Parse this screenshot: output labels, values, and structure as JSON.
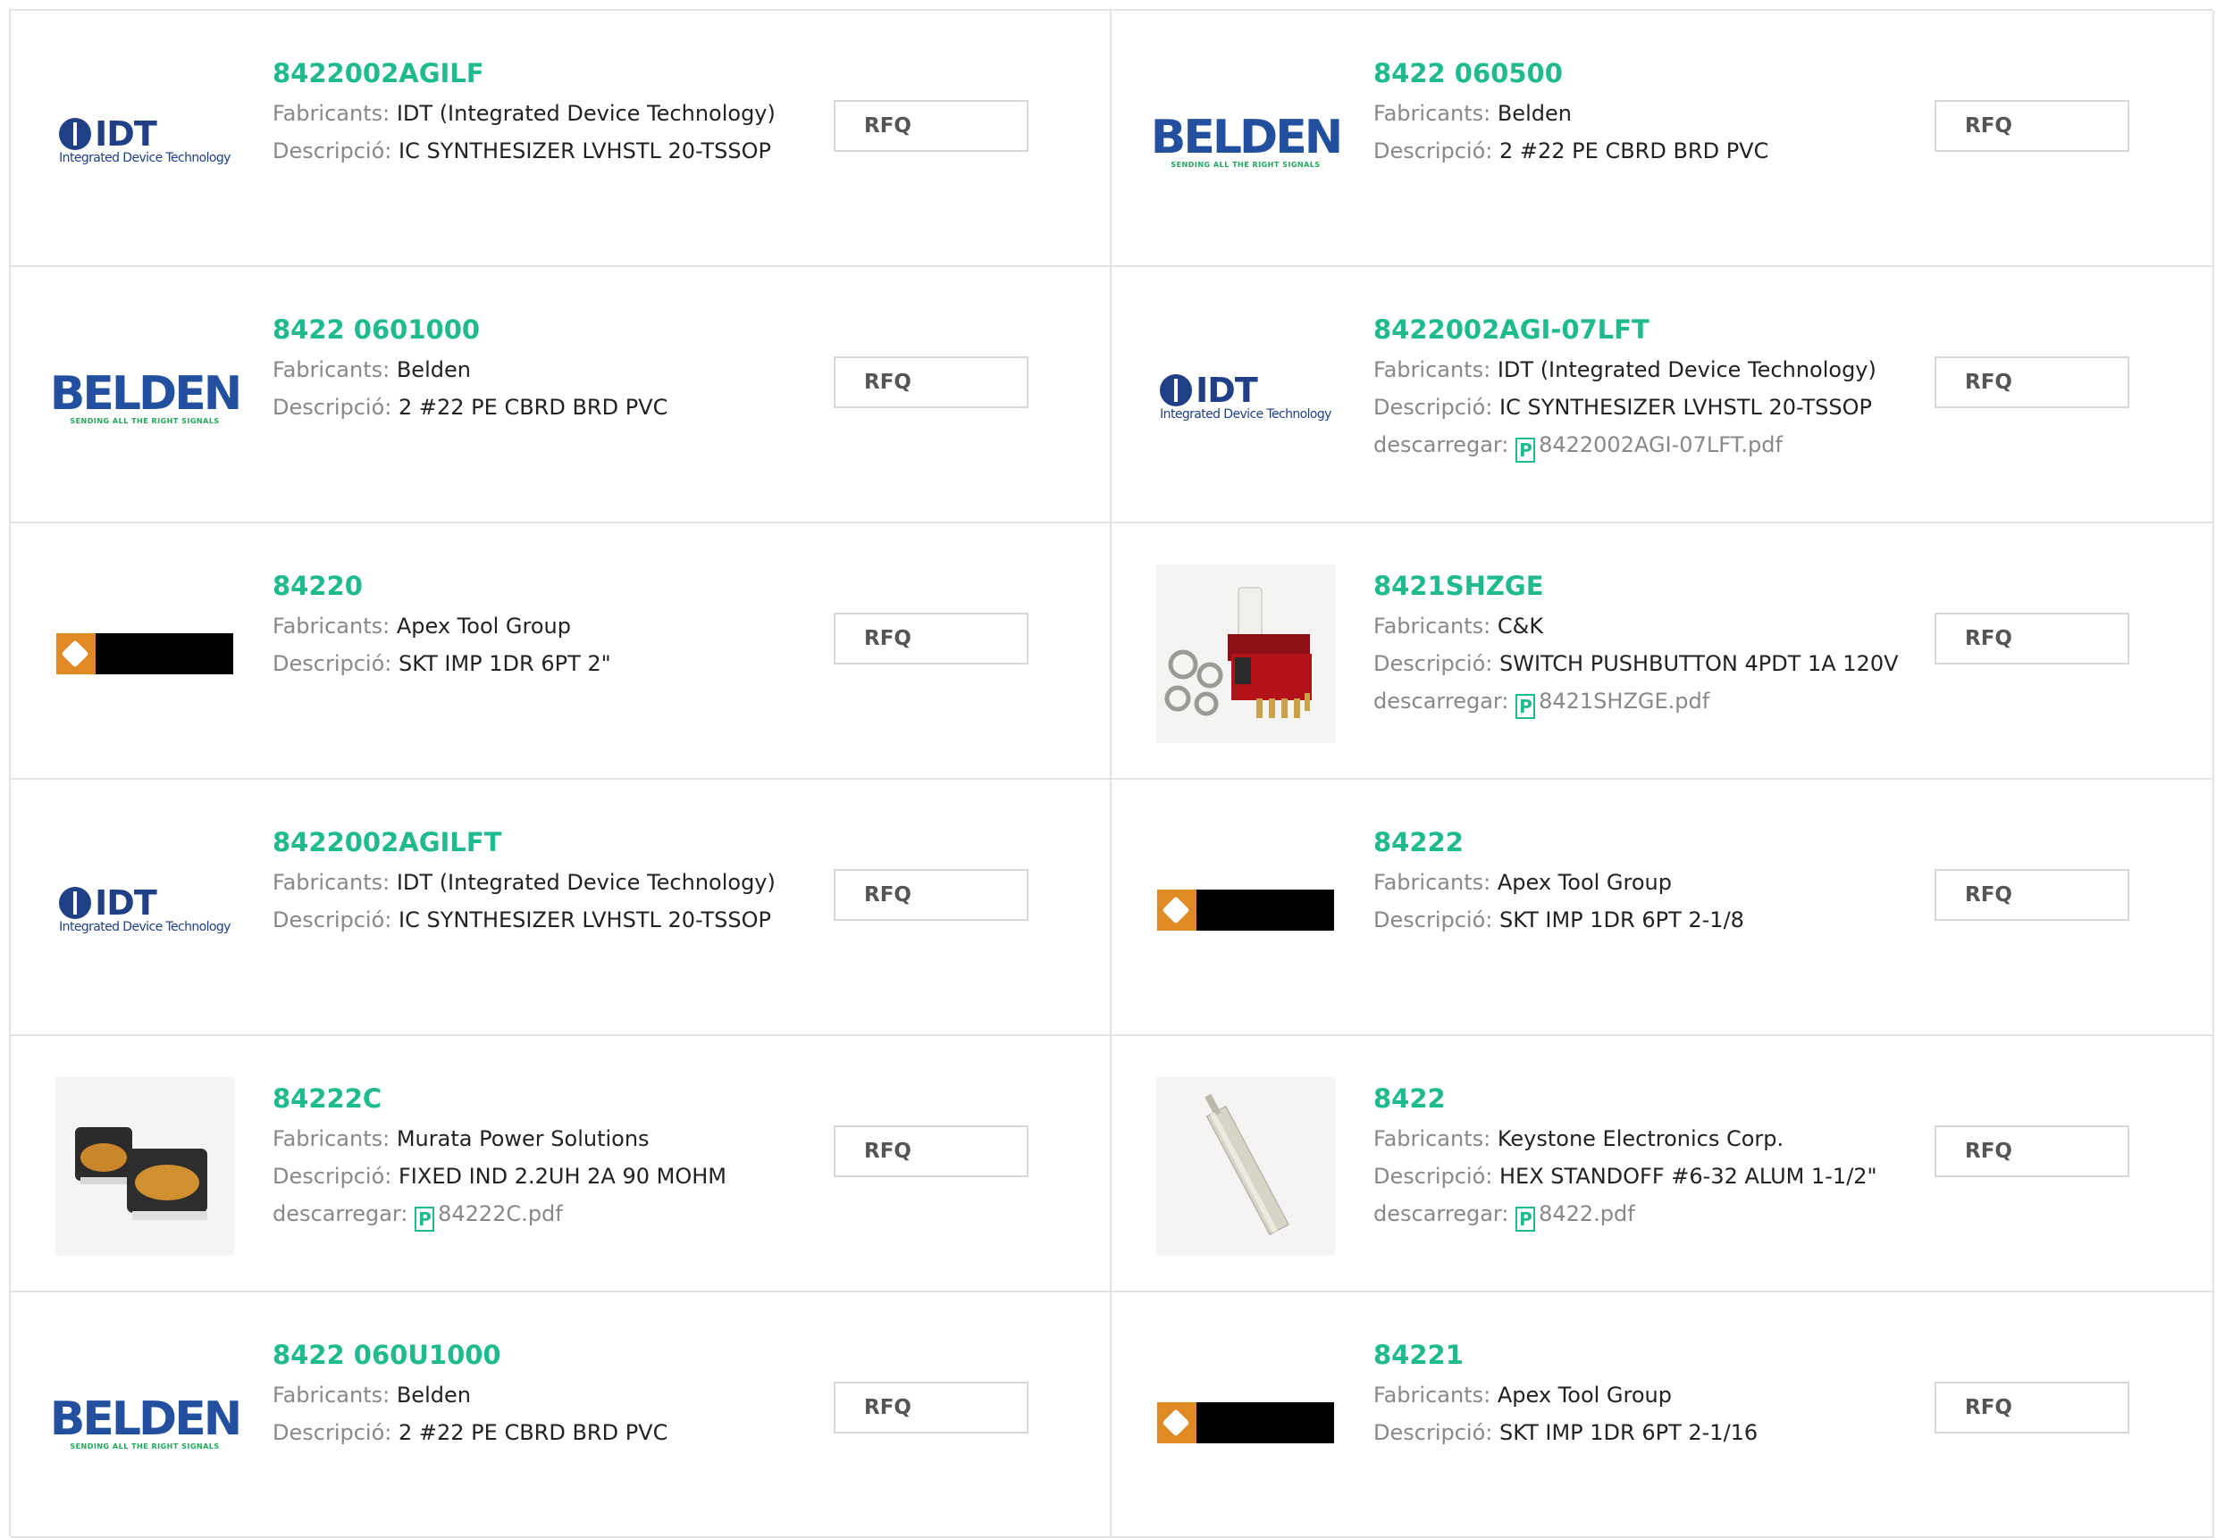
{
  "labels": {
    "manufacturer": "Fabricants:",
    "description": "Descripció:",
    "download": "descarregar:",
    "rfq": "RFQ",
    "pdf_glyph": "P"
  },
  "colors": {
    "accent": "#1fbb8f",
    "label": "#888888",
    "border": "#e3e3e3"
  },
  "products": [
    {
      "part": "8422002AGILF",
      "manufacturer": "IDT (Integrated Device Technology)",
      "description": "IC SYNTHESIZER LVHSTL 20-TSSOP",
      "logo": "idt-logo",
      "logo_text": "IDT",
      "logo_sub": "Integrated Device Technology"
    },
    {
      "part": "8422 060500",
      "manufacturer": "Belden",
      "description": "2 #22 PE CBRD BRD PVC",
      "logo": "belden-logo",
      "logo_text": "BELDEN",
      "logo_sub": "SENDING ALL THE RIGHT SIGNALS"
    },
    {
      "part": "8422 0601000",
      "manufacturer": "Belden",
      "description": "2 #22 PE CBRD BRD PVC",
      "logo": "belden-logo",
      "logo_text": "BELDEN",
      "logo_sub": "SENDING ALL THE RIGHT SIGNALS"
    },
    {
      "part": "8422002AGI-07LFT",
      "manufacturer": "IDT (Integrated Device Technology)",
      "description": "IC SYNTHESIZER LVHSTL 20-TSSOP",
      "download": "8422002AGI-07LFT.pdf",
      "logo": "idt-logo",
      "logo_text": "IDT",
      "logo_sub": "Integrated Device Technology"
    },
    {
      "part": "84220",
      "manufacturer": "Apex Tool Group",
      "description": "SKT IMP 1DR 6PT 2\"",
      "logo": "apex-logo"
    },
    {
      "part": "8421SHZGE",
      "manufacturer": "C&K",
      "description": "SWITCH PUSHBUTTON 4PDT 1A 120V",
      "download": "8421SHZGE.pdf",
      "logo": "switch-photo"
    },
    {
      "part": "8422002AGILFT",
      "manufacturer": "IDT (Integrated Device Technology)",
      "description": "IC SYNTHESIZER LVHSTL 20-TSSOP",
      "logo": "idt-logo",
      "logo_text": "IDT",
      "logo_sub": "Integrated Device Technology"
    },
    {
      "part": "84222",
      "manufacturer": "Apex Tool Group",
      "description": "SKT IMP 1DR 6PT 2-1/8",
      "logo": "apex-logo"
    },
    {
      "part": "84222C",
      "manufacturer": "Murata Power Solutions",
      "description": "FIXED IND 2.2UH 2A 90 MOHM",
      "download": "84222C.pdf",
      "logo": "inductor-photo"
    },
    {
      "part": "8422",
      "manufacturer": "Keystone Electronics Corp.",
      "description": "HEX STANDOFF #6-32 ALUM 1-1/2\"",
      "download": "8422.pdf",
      "logo": "standoff-photo"
    },
    {
      "part": "8422 060U1000",
      "manufacturer": "Belden",
      "description": "2 #22 PE CBRD BRD PVC",
      "logo": "belden-logo",
      "logo_text": "BELDEN",
      "logo_sub": "SENDING ALL THE RIGHT SIGNALS"
    },
    {
      "part": "84221",
      "manufacturer": "Apex Tool Group",
      "description": "SKT IMP 1DR 6PT 2-1/16",
      "logo": "apex-logo"
    }
  ]
}
